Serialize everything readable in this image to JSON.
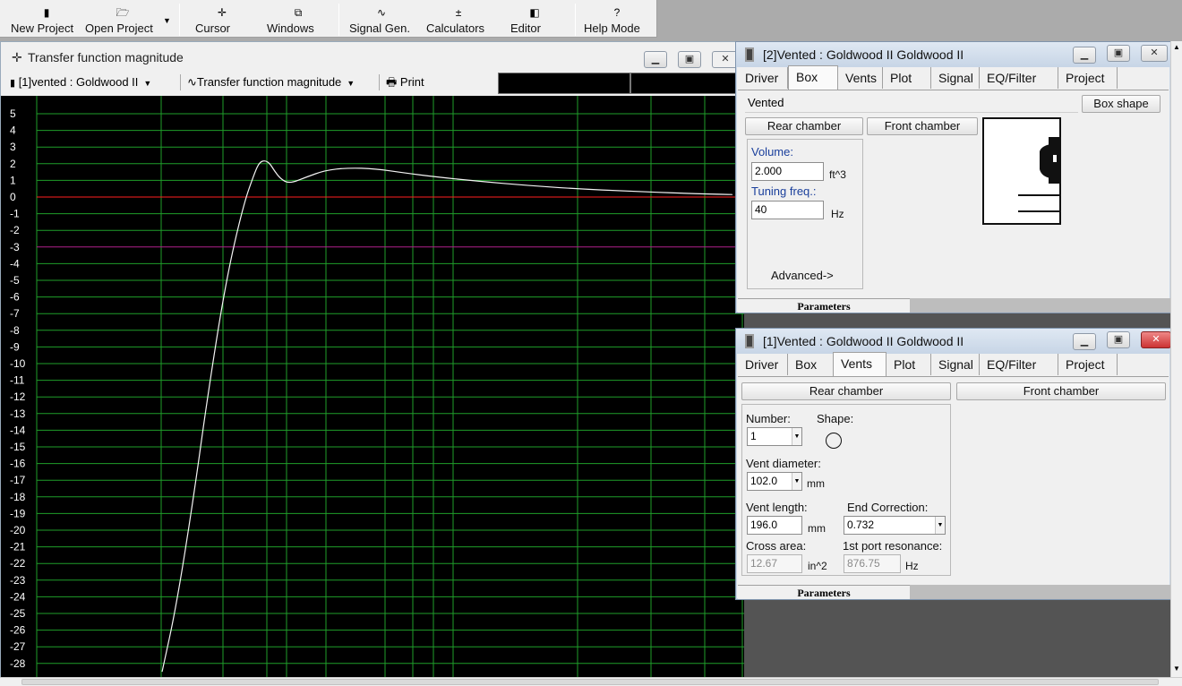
{
  "toolbar": {
    "buttons": [
      {
        "label": "New Project",
        "icon": "new-project-icon",
        "glyph": "▮"
      },
      {
        "label": "Open Project",
        "icon": "open-project-icon",
        "glyph": "🗁"
      },
      {
        "label": "Cursor",
        "icon": "cursor-icon",
        "glyph": "✛"
      },
      {
        "label": "Windows",
        "icon": "windows-icon",
        "glyph": "⧉"
      },
      {
        "label": "Signal Gen.",
        "icon": "signal-gen-icon",
        "glyph": "∿"
      },
      {
        "label": "Calculators",
        "icon": "calculators-icon",
        "glyph": "±"
      },
      {
        "label": "Editor",
        "icon": "editor-icon",
        "glyph": "◧"
      },
      {
        "label": "Help Mode",
        "icon": "help-icon",
        "glyph": "?"
      }
    ]
  },
  "plot_window": {
    "title": "Transfer function magnitude",
    "project_select": "[1]vented : Goldwood II",
    "plot_type_select": "Transfer function magnitude",
    "print_label": "Print"
  },
  "chart_data": {
    "type": "line",
    "xlabel": "",
    "ylabel": "",
    "ylim": [
      -29,
      5.5
    ],
    "y_ticks": [
      5,
      4,
      3,
      2,
      1,
      0,
      -1,
      -2,
      -3,
      -4,
      -5,
      -6,
      -7,
      -8,
      -9,
      -10,
      -11,
      -12,
      -13,
      -14,
      -15,
      -16,
      -17,
      -18,
      -19,
      -20,
      -21,
      -22,
      -23,
      -24,
      -25,
      -26,
      -27,
      -28
    ],
    "grid": true,
    "reference_lines": [
      {
        "name": "0 dB",
        "y": 0,
        "color": "#ff2020"
      },
      {
        "name": "-3 dB",
        "y": -3,
        "color": "#b0208c"
      }
    ],
    "colors": {
      "background": "#000000",
      "grid": "#1f9e2a",
      "curve": "#f4f4f4",
      "tick_text": "#ffffff"
    },
    "series": [
      {
        "x_rel": [
          0,
          0.021,
          0.046,
          0.066,
          0.093,
          0.118,
          0.135,
          0.142,
          0.15,
          0.157,
          0.163,
          0.172,
          0.185,
          0.21,
          0.237,
          0.27,
          0.31,
          0.352,
          0.4,
          0.46,
          0.53,
          0.6,
          0.68,
          0.76,
          0.83
        ],
        "values": [
          -28.5,
          -24.5,
          -18.0,
          -12.0,
          -5.0,
          -0.5,
          1.5,
          2.1,
          2.2,
          2.0,
          1.6,
          1.1,
          0.8,
          1.2,
          1.6,
          1.75,
          1.7,
          1.45,
          1.2,
          0.95,
          0.7,
          0.5,
          0.35,
          0.22,
          0.15
        ]
      }
    ]
  },
  "box_dialog": {
    "title": "[2]Vented : Goldwood II Goldwood II",
    "tabs": [
      "Driver",
      "Box",
      "Vents",
      "Plot",
      "Signal",
      "EQ/Filter",
      "Project"
    ],
    "active_tab": "Box",
    "box_type": "Vented",
    "box_shape_button": "Box shape",
    "rear_chamber": "Rear chamber",
    "front_chamber": "Front chamber",
    "volume_label": "Volume:",
    "volume_value": "2.000",
    "volume_unit": "ft^3",
    "tuning_label": "Tuning freq.:",
    "tuning_value": "40",
    "tuning_unit": "Hz",
    "advanced_label": "Advanced->",
    "parameters_tab": "Parameters"
  },
  "vents_dialog": {
    "title": "[1]Vented : Goldwood II Goldwood II",
    "tabs": [
      "Driver",
      "Box",
      "Vents",
      "Plot",
      "Signal",
      "EQ/Filter",
      "Project"
    ],
    "active_tab": "Vents",
    "rear_chamber": "Rear chamber",
    "front_chamber": "Front chamber",
    "number_label": "Number:",
    "number_value": "1",
    "shape_label": "Shape:",
    "diameter_label": "Vent diameter:",
    "diameter_value": "102.0",
    "diameter_unit": "mm",
    "length_label": "Vent length:",
    "length_value": "196.0",
    "length_unit": "mm",
    "end_correction_label": "End Correction:",
    "end_correction_value": "0.732",
    "cross_area_label": "Cross area:",
    "cross_area_value": "12.67",
    "cross_area_unit": "in^2",
    "port_resonance_label": "1st port resonance:",
    "port_resonance_value": "876.75",
    "port_resonance_unit": "Hz",
    "parameters_tab": "Parameters"
  }
}
